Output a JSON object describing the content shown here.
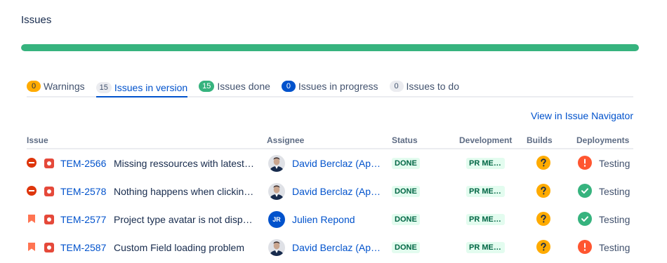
{
  "page": {
    "title": "Issues"
  },
  "progress": {
    "percent_done": 100,
    "color": "#36b37e"
  },
  "tabs": [
    {
      "count": "0",
      "label": "Warnings",
      "count_style": "c-yellow",
      "active": false
    },
    {
      "count": "15",
      "label": "Issues in version",
      "count_style": "c-grey",
      "active": true
    },
    {
      "count": "15",
      "label": "Issues done",
      "count_style": "c-green",
      "active": false
    },
    {
      "count": "0",
      "label": "Issues in progress",
      "count_style": "c-blue",
      "active": false
    },
    {
      "count": "0",
      "label": "Issues to do",
      "count_style": "c-grey",
      "active": false
    }
  ],
  "view_link": "View in Issue Navigator",
  "columns": {
    "issue": "Issue",
    "assignee": "Assignee",
    "status": "Status",
    "development": "Development",
    "builds": "Builds",
    "deployments": "Deployments"
  },
  "rows": [
    {
      "priority_icon": "blocker-icon",
      "type_icon": "bug-icon",
      "key": "TEM-2566",
      "summary": "Missing ressources with latest version",
      "assignee": "David Berclaz (Apwide)",
      "avatar": "photo",
      "avatar_initials": "",
      "status": "DONE",
      "development": "PR MERGED",
      "build_icon": "question-icon",
      "deployment_icon": "error-icon",
      "deployment": "Testing"
    },
    {
      "priority_icon": "blocker-icon",
      "type_icon": "bug-icon",
      "key": "TEM-2578",
      "summary": "Nothing happens when clicking on button",
      "assignee": "David Berclaz (Apwide)",
      "avatar": "photo",
      "avatar_initials": "",
      "status": "DONE",
      "development": "PR MERGED",
      "build_icon": "question-icon",
      "deployment_icon": "success-icon",
      "deployment": "Testing"
    },
    {
      "priority_icon": "highest-icon",
      "type_icon": "bug-icon",
      "key": "TEM-2577",
      "summary": "Project type avatar is not displayed",
      "assignee": "Julien Repond",
      "avatar": "initials",
      "avatar_initials": "JR",
      "status": "DONE",
      "development": "PR MERGED",
      "build_icon": "question-icon",
      "deployment_icon": "success-icon",
      "deployment": "Testing"
    },
    {
      "priority_icon": "highest-icon",
      "type_icon": "bug-icon",
      "key": "TEM-2587",
      "summary": "Custom Field loading problem",
      "assignee": "David Berclaz (Apwide)",
      "avatar": "photo",
      "avatar_initials": "",
      "status": "DONE",
      "development": "PR MERGED",
      "build_icon": "question-icon",
      "deployment_icon": "error-icon",
      "deployment": "Testing"
    }
  ]
}
